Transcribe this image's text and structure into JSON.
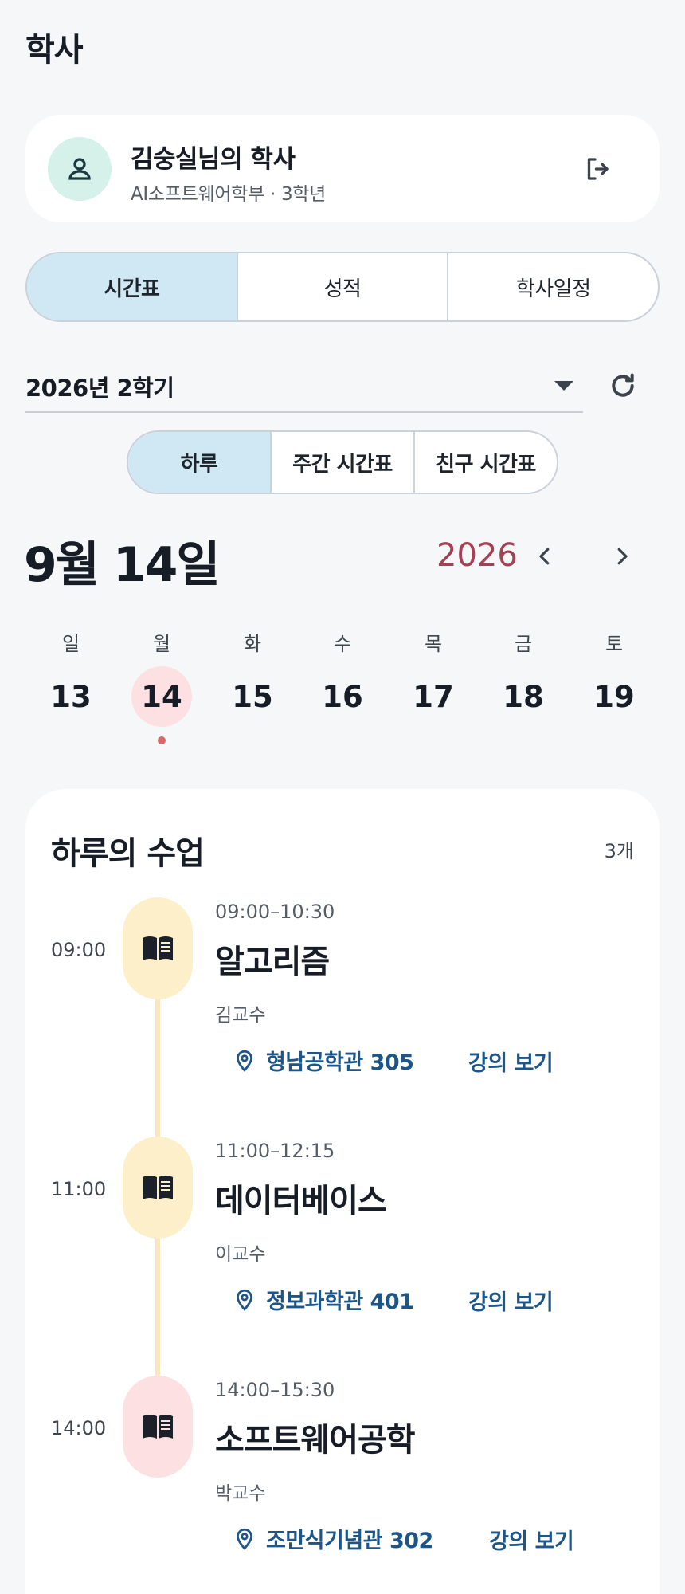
{
  "page": {
    "title": "학사"
  },
  "profile": {
    "name": "김숭실님의 학사",
    "subtitle": "AI소프트웨어학부 · 3학년"
  },
  "main_tabs": [
    {
      "label": "시간표",
      "active": true
    },
    {
      "label": "성적",
      "active": false
    },
    {
      "label": "학사일정",
      "active": false
    }
  ],
  "semester": {
    "selected": "2026년 2학기"
  },
  "view_tabs": [
    {
      "label": "하루",
      "active": true
    },
    {
      "label": "주간 시간표",
      "active": false
    },
    {
      "label": "친구 시간표",
      "active": false
    }
  ],
  "date_header": {
    "date": "9월 14일",
    "year": "2026"
  },
  "week": [
    {
      "day": "일",
      "date": "13"
    },
    {
      "day": "월",
      "date": "14",
      "selected": true
    },
    {
      "day": "화",
      "date": "15"
    },
    {
      "day": "수",
      "date": "16"
    },
    {
      "day": "목",
      "date": "17"
    },
    {
      "day": "금",
      "date": "18"
    },
    {
      "day": "토",
      "date": "19"
    }
  ],
  "classes_section": {
    "title": "하루의 수업",
    "count": "3개",
    "classes": [
      {
        "start": "09:00",
        "range": "09:00–10:30",
        "name": "알고리즘",
        "professor": "김교수",
        "location": "형남공학관 305",
        "link_label": "강의 보기",
        "icon": "book-icon",
        "color": "#fcefc9"
      },
      {
        "start": "11:00",
        "range": "11:00–12:15",
        "name": "데이터베이스",
        "professor": "이교수",
        "location": "정보과학관 401",
        "link_label": "강의 보기",
        "icon": "book-icon",
        "color": "#fcefc9"
      },
      {
        "start": "14:00",
        "range": "14:00–15:30",
        "name": "소프트웨어공학",
        "professor": "박교수",
        "location": "조만식기념관 302",
        "link_label": "강의 보기",
        "icon": "book-icon",
        "color": "#fde0e2"
      }
    ]
  },
  "colors": {
    "accent_tab": "#cfe8f3",
    "year": "#a64054",
    "link": "#1c558a",
    "today_dot": "#d8686c"
  }
}
